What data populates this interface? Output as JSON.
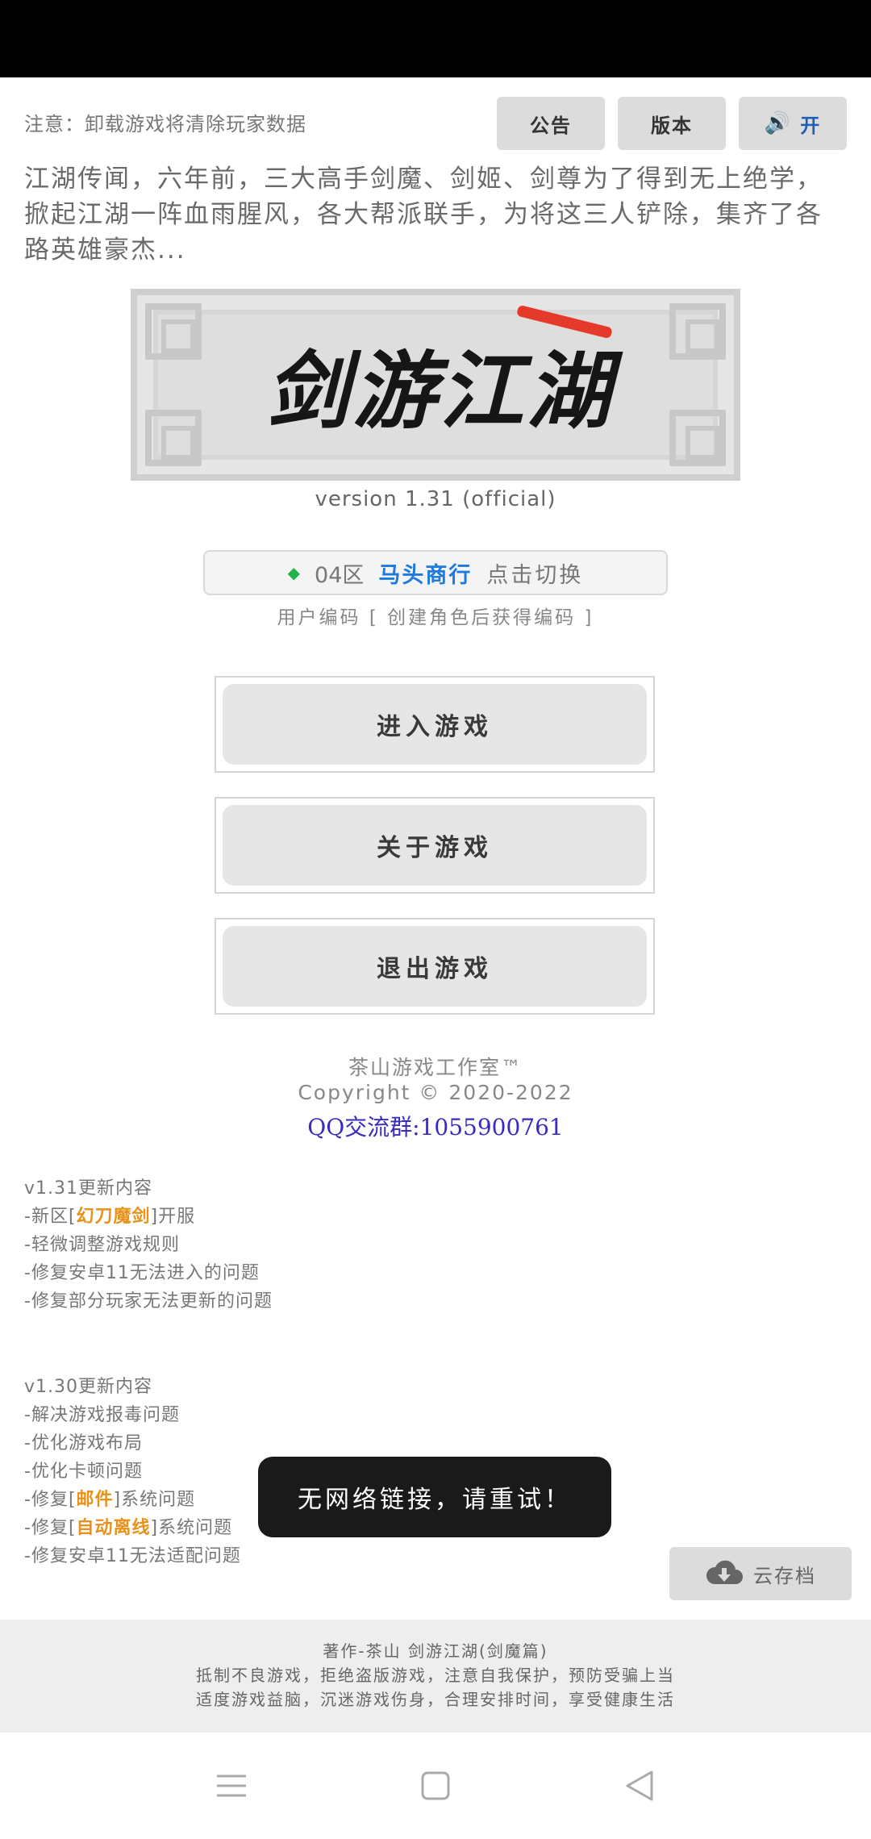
{
  "header": {
    "notice": "注意：卸载游戏将清除玩家数据",
    "btn_announce": "公告",
    "btn_version": "版本",
    "btn_sound_label": "开"
  },
  "intro": "江湖传闻，六年前，三大高手剑魔、剑姬、剑尊为了得到无上绝学，掀起江湖一阵血雨腥风，各大帮派联手，为将这三人铲除，集齐了各路英雄豪杰...",
  "logo": {
    "title": "剑游江湖"
  },
  "version": "version 1.31 (official)",
  "server": {
    "zone": "04区",
    "name": "马头商行",
    "action": "点击切换"
  },
  "usercode": "用户编码 [ 创建角色后获得编码 ]",
  "menu": {
    "enter": "进入游戏",
    "about": "关于游戏",
    "exit": "退出游戏"
  },
  "studio": {
    "name": "茶山游戏工作室™",
    "copyright": "Copyright © 2020-2022",
    "qq": "QQ交流群:1055900761"
  },
  "changelog_131": {
    "title": "v1.31更新内容",
    "l1_pre": "-新区[",
    "l1_hl": "幻刀魔剑",
    "l1_post": "]开服",
    "l2": "-轻微调整游戏规则",
    "l3": "-修复安卓11无法进入的问题",
    "l4": "-修复部分玩家无法更新的问题"
  },
  "changelog_130": {
    "title": "v1.30更新内容",
    "l1": "-解决游戏报毒问题",
    "l2": "-优化游戏布局",
    "l3": "-优化卡顿问题",
    "l4_pre": "-修复[",
    "l4_hl": "邮件",
    "l4_post": "]系统问题",
    "l5_pre": "-修复[",
    "l5_hl": "自动离线",
    "l5_post": "]系统问题",
    "l6": "-修复安卓11无法适配问题"
  },
  "toast": "无网络链接，请重试！",
  "cloud_save": "云存档",
  "footer": {
    "line1": "著作-茶山   剑游江湖(剑魔篇)",
    "line2": "抵制不良游戏，拒绝盗版游戏，注意自我保护，预防受骗上当",
    "line3": "适度游戏益脑，沉迷游戏伤身，合理安排时间，享受健康生活"
  },
  "colors": {
    "highlight": "#e8921e",
    "server_name": "#1d7be0",
    "qq": "#3a2bbf",
    "online_dot": "#21b34a"
  }
}
